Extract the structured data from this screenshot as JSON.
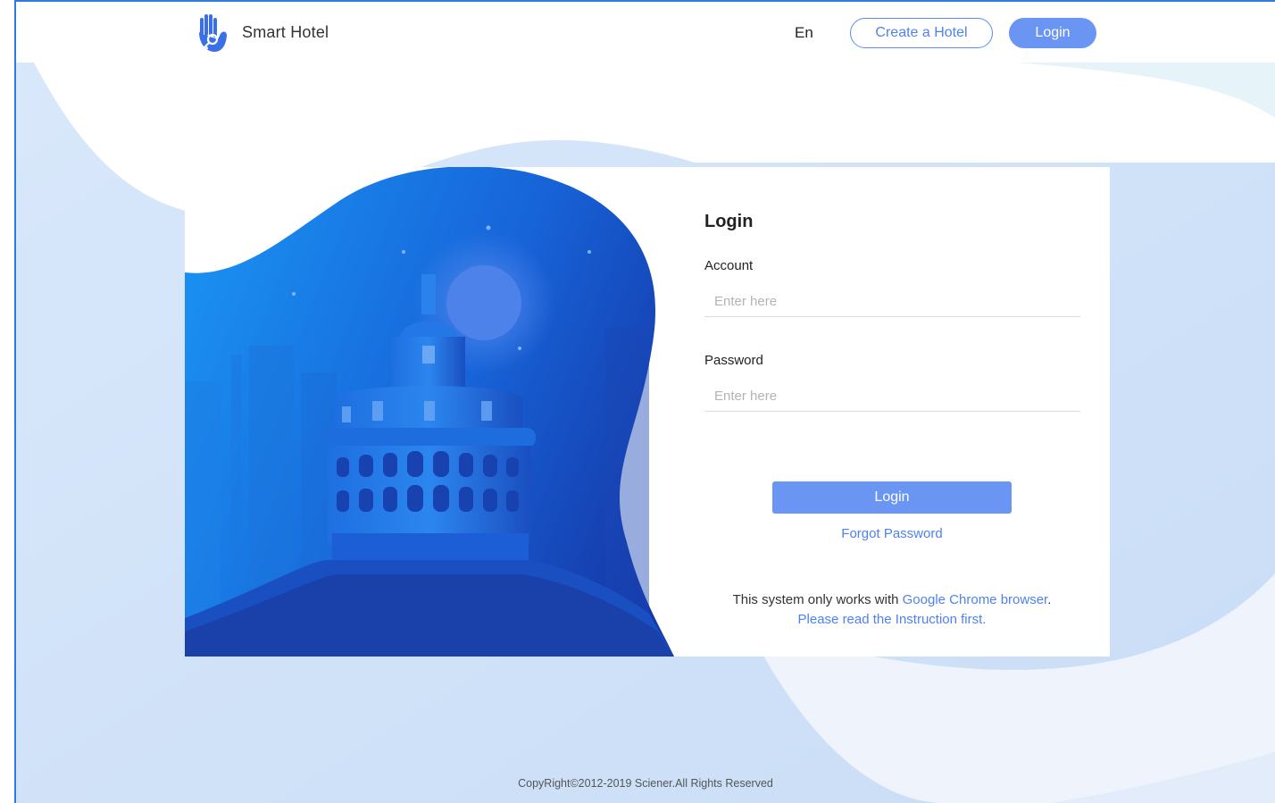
{
  "header": {
    "brand_name": "Smart Hotel",
    "language": "En",
    "create_hotel_label": "Create a Hotel",
    "login_label": "Login"
  },
  "login_form": {
    "title": "Login",
    "account_label": "Account",
    "account_placeholder": "Enter here",
    "password_label": "Password",
    "password_placeholder": "Enter here",
    "submit_label": "Login",
    "forgot_password": "Forgot Password",
    "notice_text": "This system only works with",
    "notice_link": "Google Chrome browser",
    "notice_period": ".",
    "instruction_link": "Please read the Instruction first."
  },
  "footer": {
    "copyright": "CopyRight©2012-2019 Sciener.All Rights Reserved"
  },
  "colors": {
    "accent": "#6b95f3",
    "link": "#4f82ee",
    "frame": "#2f7ae5",
    "illustration_dark": "#1538a8",
    "illustration_light": "#1a8ef0"
  },
  "icons": {
    "logo": "hand-key-icon"
  }
}
